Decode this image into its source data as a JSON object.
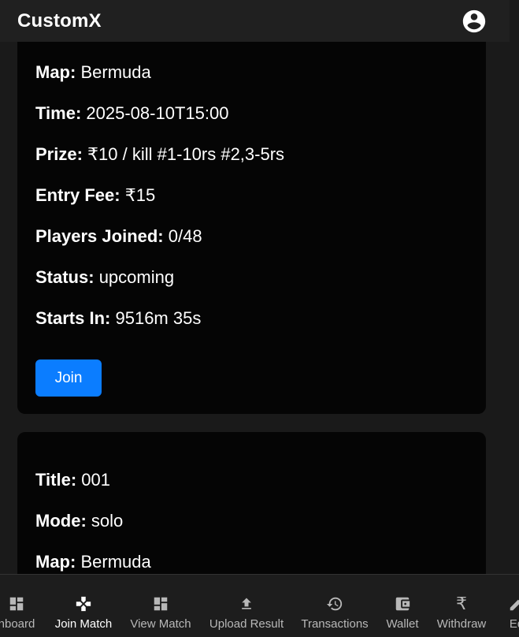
{
  "app": {
    "title": "CustomX"
  },
  "cards": [
    {
      "rows": [
        {
          "label": "Map:",
          "value": "Bermuda"
        },
        {
          "label": "Time:",
          "value": "2025-08-10T15:00"
        },
        {
          "label": "Prize:",
          "value": "₹10 / kill #1-10rs #2,3-5rs"
        },
        {
          "label": "Entry Fee:",
          "value": "₹15"
        },
        {
          "label": "Players Joined:",
          "value": "0/48"
        },
        {
          "label": "Status:",
          "value": "upcoming"
        },
        {
          "label": "Starts In:",
          "value": "9516m 35s"
        }
      ],
      "join_label": "Join"
    },
    {
      "rows": [
        {
          "label": "Title:",
          "value": "001"
        },
        {
          "label": "Mode:",
          "value": "solo"
        },
        {
          "label": "Map:",
          "value": "Bermuda"
        }
      ]
    }
  ],
  "nav": [
    {
      "label": "hboard",
      "icon": "dashboard-icon"
    },
    {
      "label": "Join Match",
      "icon": "gamepad-icon",
      "active": true
    },
    {
      "label": "View Match",
      "icon": "grid-icon"
    },
    {
      "label": "Upload Result",
      "icon": "upload-icon"
    },
    {
      "label": "Transactions",
      "icon": "history-icon"
    },
    {
      "label": "Wallet",
      "icon": "wallet-icon"
    },
    {
      "label": "Withdraw",
      "icon": "rupee-icon"
    },
    {
      "label": "Ed",
      "icon": "edit-icon"
    }
  ],
  "colors": {
    "accent": "#0b7dff",
    "card_bg": "#050505",
    "page_bg": "#1a1a1a",
    "topbar_bg": "#202020"
  }
}
